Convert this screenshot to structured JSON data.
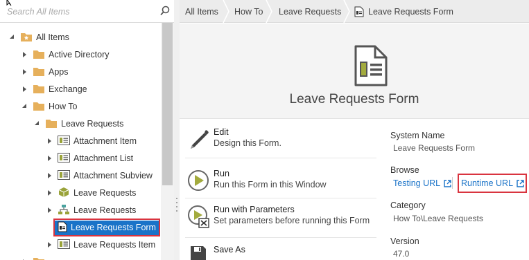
{
  "search": {
    "placeholder": "Search All Items"
  },
  "tree": {
    "items": [
      {
        "label": "All Items",
        "icon": "folder-star-icon"
      },
      {
        "label": "Active Directory",
        "icon": "folder-icon"
      },
      {
        "label": "Apps",
        "icon": "folder-icon"
      },
      {
        "label": "Exchange",
        "icon": "folder-icon"
      },
      {
        "label": "How To",
        "icon": "folder-icon"
      },
      {
        "label": "Leave Requests",
        "icon": "folder-icon"
      },
      {
        "label": "Attachment Item",
        "icon": "view-icon"
      },
      {
        "label": "Attachment List",
        "icon": "view-icon"
      },
      {
        "label": "Attachment Subview",
        "icon": "view-icon"
      },
      {
        "label": "Leave Requests",
        "icon": "smartobject-icon"
      },
      {
        "label": "Leave Requests",
        "icon": "workflow-icon"
      },
      {
        "label": "Leave Requests Form",
        "icon": "form-icon"
      },
      {
        "label": "Leave Requests Item",
        "icon": "view-icon"
      }
    ]
  },
  "breadcrumb": [
    "All Items",
    "How To",
    "Leave Requests",
    "Leave Requests Form"
  ],
  "main": {
    "title": "Leave Requests Form",
    "actions": [
      {
        "title": "Edit",
        "desc": "Design this Form.",
        "icon": "pencil-icon"
      },
      {
        "title": "Run",
        "desc": "Run this Form in this Window",
        "icon": "play-icon"
      },
      {
        "title": "Run with Parameters",
        "desc": "Set parameters before running this Form",
        "icon": "play-params-icon"
      },
      {
        "title": "Save As",
        "desc": "",
        "icon": "save-as-icon"
      }
    ],
    "properties": {
      "system_name_label": "System Name",
      "system_name_value": "Leave Requests Form",
      "browse_label": "Browse",
      "testing_url": "Testing URL",
      "runtime_url": "Runtime URL",
      "category_label": "Category",
      "category_value": "How To\\Leave Requests",
      "version_label": "Version",
      "version_value": "47.0"
    }
  },
  "colors": {
    "accent": "#1a73c8",
    "highlight": "#d9343f",
    "folder": "#e6b05c",
    "form_icon": "#9aa33a"
  }
}
